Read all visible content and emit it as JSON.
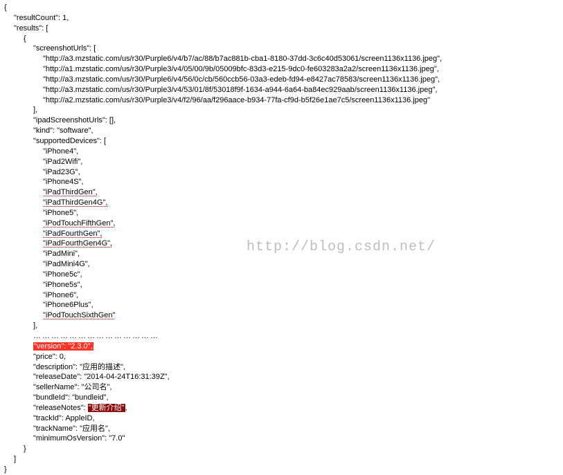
{
  "watermark": "http://blog.csdn.net/",
  "json": {
    "resultCount_key": "\"resultCount\": 1,",
    "results_key": "\"results\": [",
    "screenshotUrls_key": "\"screenshotUrls\": [",
    "screenshotUrls": [
      "\"http://a3.mzstatic.com/us/r30/Purple6/v4/b7/ac/88/b7ac881b-cba1-8180-37dd-3c6c40d53061/screen1136x1136.jpeg\",",
      "\"http://a1.mzstatic.com/us/r30/Purple3/v4/05/00/9b/05009bfc-83d3-e215-9dc0-fe603283a2a2/screen1136x1136.jpeg\",",
      "\"http://a3.mzstatic.com/us/r30/Purple6/v4/56/0c/cb/560ccb56-03a3-edeb-fd94-e8427ac78583/screen1136x1136.jpeg\",",
      "\"http://a3.mzstatic.com/us/r30/Purple3/v4/53/01/8f/53018f9f-1634-a944-6a64-ba84ec929aab/screen1136x1136.jpeg\",",
      "\"http://a2.mzstatic.com/us/r30/Purple3/v4/f2/96/aa/f296aace-b934-77fa-cf9d-b5f26e1ae7c5/screen1136x1136.jpeg\""
    ],
    "ipadScreenshotUrls": "\"ipadScreenshotUrls\": [],",
    "kind": "\"kind\": \"software\",",
    "supportedDevices_key": "\"supportedDevices\": [",
    "devices": [
      {
        "text": "\"iPhone4\",",
        "spell": false
      },
      {
        "text": "\"iPad2Wifi\",",
        "spell": false
      },
      {
        "text": "\"iPad23G\",",
        "spell": false
      },
      {
        "text": "\"iPhone4S\",",
        "spell": false
      },
      {
        "text": "\"iPadThirdGen\",",
        "spell": true
      },
      {
        "text": "\"iPadThirdGen4G\",",
        "spell": true
      },
      {
        "text": "\"iPhone5\",",
        "spell": false
      },
      {
        "text": "\"iPodTouchFifthGen\",",
        "spell": true
      },
      {
        "text": "\"iPadFourthGen\",",
        "spell": true
      },
      {
        "text": "\"iPadFourthGen4G\",",
        "spell": true
      },
      {
        "text": "\"iPadMini\",",
        "spell": false
      },
      {
        "text": "\"iPadMini4G\",",
        "spell": false
      },
      {
        "text": "\"iPhone5c\",",
        "spell": false
      },
      {
        "text": "\"iPhone5s\",",
        "spell": false
      },
      {
        "text": "\"iPhone6\",",
        "spell": false
      },
      {
        "text": "\"iPhone6Plus\",",
        "spell": false
      },
      {
        "text": "\"iPodTouchSixthGen\"",
        "spell": true
      }
    ],
    "omitted": "……………………………………",
    "version_hl": "\"version\": \"2.3.0\",",
    "price": "\"price\": 0,",
    "description": "\"description\": \"应用的描述\",",
    "releaseDate": "\"releaseDate\": \"2014-04-24T16:31:39Z\",",
    "sellerName": "\"sellerName\": \"公司名\",",
    "bundleId": "\"bundleId\": \"bundleid\",",
    "releaseNotes_key": "\"releaseNotes\": ",
    "releaseNotes_val": "\"更新介绍\"",
    "releaseNotes_comma": ",",
    "trackId": "\"trackId\": AppleID,",
    "trackName": "\"trackName\": \"应用名\",",
    "minimumOsVersion": "\"minimumOsVersion\": \"7.0\""
  }
}
